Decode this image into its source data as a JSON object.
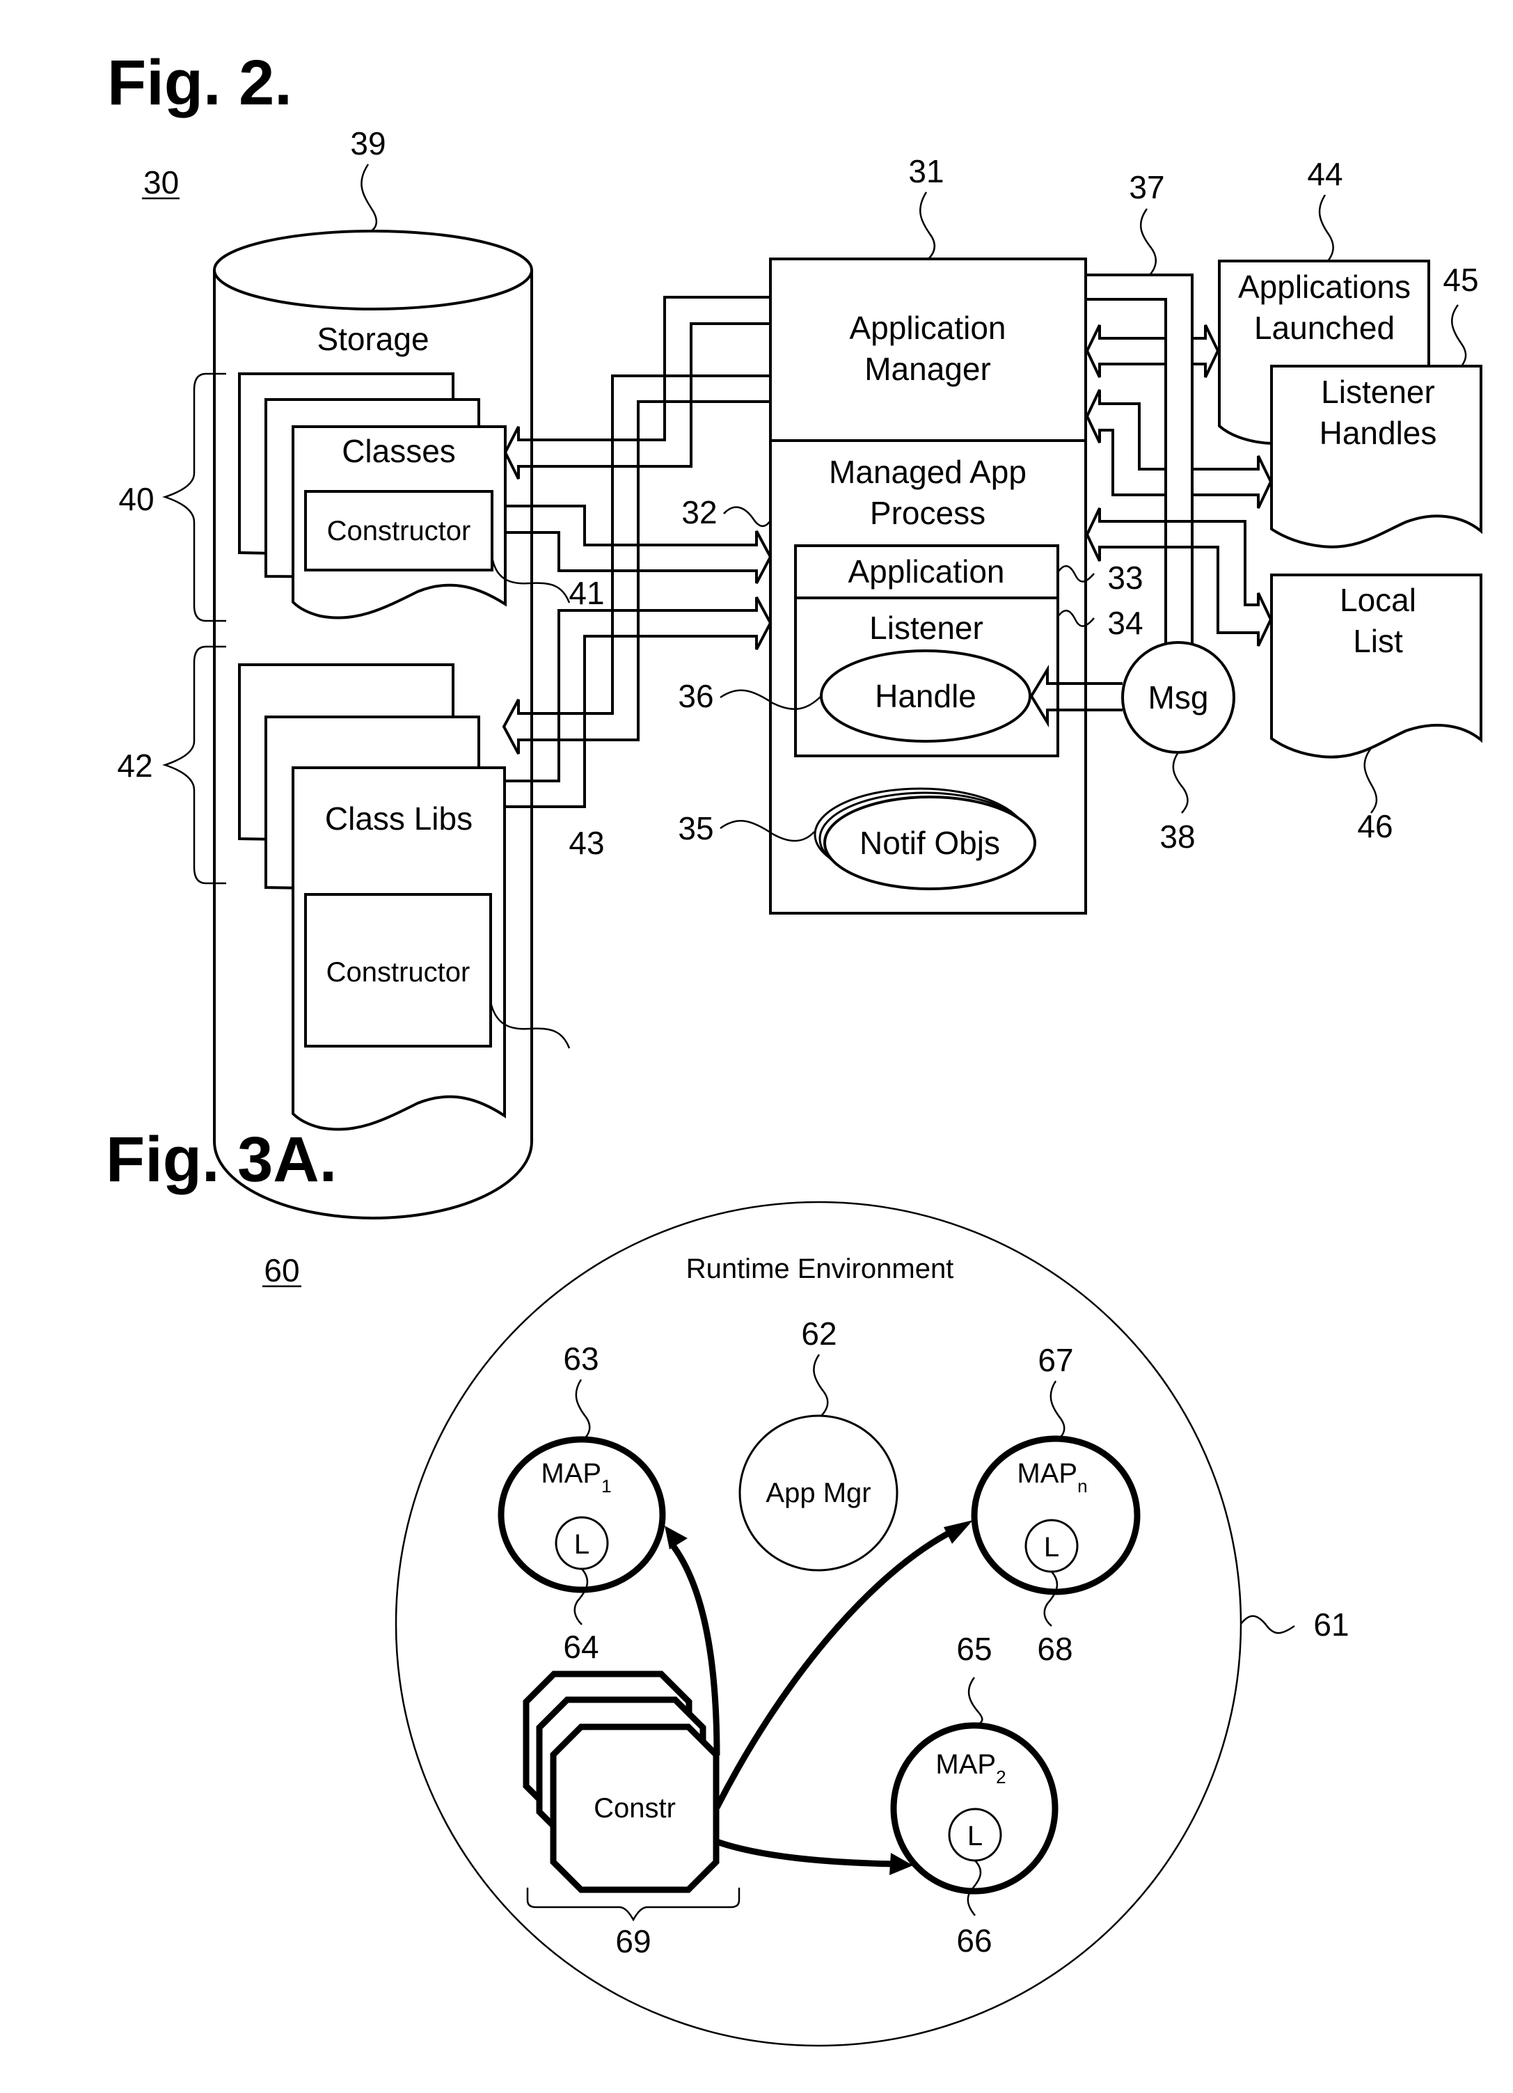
{
  "fig2": {
    "title": "Fig. 2.",
    "ref_system": "30",
    "storage": {
      "ref": "39",
      "label": "Storage"
    },
    "classes": {
      "group_ref": "40",
      "label": "Classes",
      "constructor_label": "Constructor",
      "constructor_ref": "41"
    },
    "class_libs": {
      "group_ref": "42",
      "label": "Class Libs",
      "constructor_label": "Constructor",
      "constructor_ref": "43"
    },
    "app_manager": {
      "ref": "31",
      "label_line1": "Application",
      "label_line2": "Manager"
    },
    "managed_app_process": {
      "ref": "32",
      "label_line1": "Managed App",
      "label_line2": "Process"
    },
    "application": {
      "ref": "33",
      "label": "Application"
    },
    "listener": {
      "ref": "34",
      "label": "Listener"
    },
    "handle": {
      "ref": "36",
      "label": "Handle"
    },
    "notif_objs": {
      "ref": "35",
      "label": "Notif Objs"
    },
    "bus": {
      "ref": "37"
    },
    "msg": {
      "ref": "38",
      "label": "Msg"
    },
    "applications_launched": {
      "ref": "44",
      "label_line1": "Applications",
      "label_line2": "Launched"
    },
    "listener_handles": {
      "ref": "45",
      "label_line1": "Listener",
      "label_line2": "Handles"
    },
    "local_list": {
      "ref": "46",
      "label_line1": "Local",
      "label_line2": "List"
    }
  },
  "fig3a": {
    "title": "Fig. 3A.",
    "ref_system": "60",
    "runtime_environment": {
      "ref": "61",
      "label": "Runtime Environment"
    },
    "app_mgr": {
      "ref": "62",
      "label": "App Mgr"
    },
    "map1": {
      "ref": "63",
      "label": "MAP",
      "subscript": "1",
      "listener_label": "L",
      "listener_ref": "64"
    },
    "map2": {
      "ref": "65",
      "label": "MAP",
      "subscript": "2",
      "listener_label": "L",
      "listener_ref": "66"
    },
    "mapn": {
      "ref": "67",
      "label": "MAP",
      "subscript": "n",
      "listener_label": "L",
      "listener_ref": "68"
    },
    "constructors": {
      "ref": "69",
      "label": "Constr"
    }
  }
}
